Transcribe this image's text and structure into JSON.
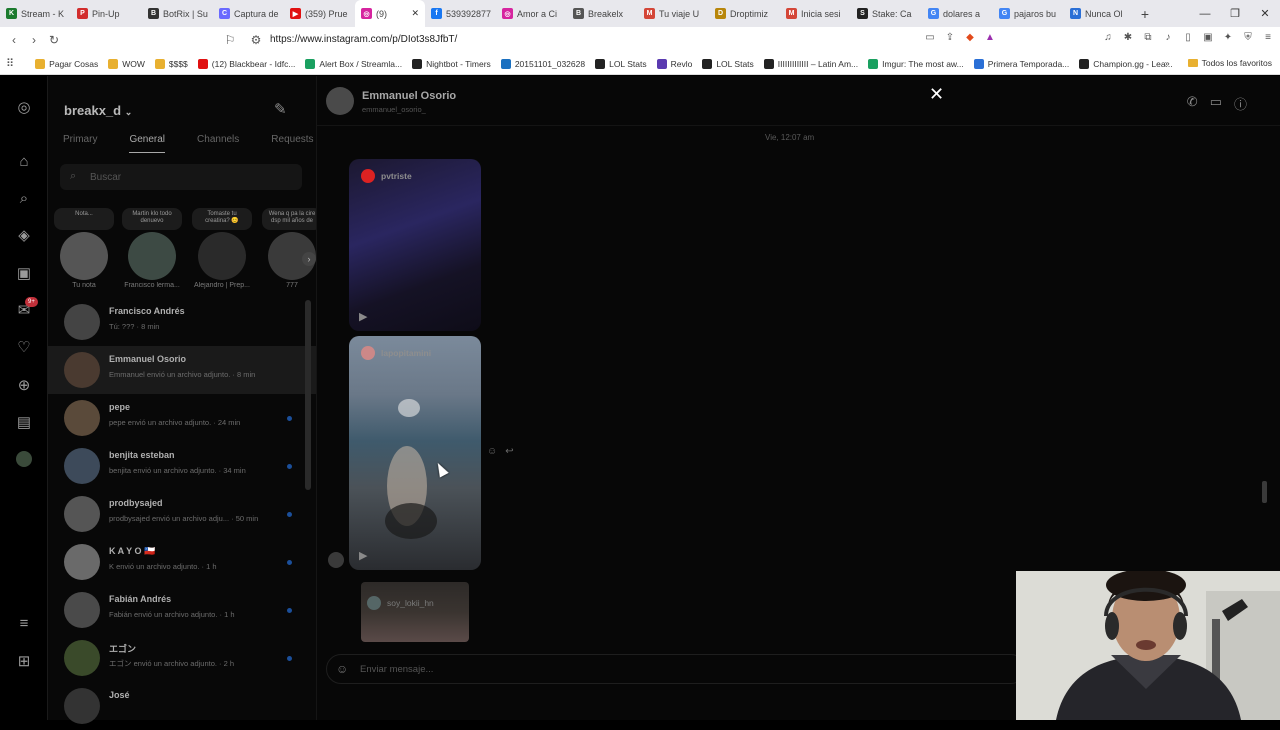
{
  "browser": {
    "tabs": [
      {
        "label": "Stream - K",
        "color": "#1b7a2e",
        "glyph": "K"
      },
      {
        "label": "Pin-Up",
        "color": "#d22d2d",
        "glyph": "P"
      },
      {
        "label": "BotRix | Su",
        "color": "#333333",
        "glyph": "B"
      },
      {
        "label": "Captura de",
        "color": "#6a6aff",
        "glyph": "C"
      },
      {
        "label": "(359) Prue",
        "color": "#e01010",
        "glyph": "▶"
      },
      {
        "label": "(9)",
        "color": "#d6249f",
        "glyph": "◎",
        "active": true
      },
      {
        "label": "539392877",
        "color": "#1877f2",
        "glyph": "f"
      },
      {
        "label": "Amor a Ci",
        "color": "#d6249f",
        "glyph": "◎"
      },
      {
        "label": "Breakelx",
        "color": "#555555",
        "glyph": "B"
      },
      {
        "label": "Tu viaje U",
        "color": "#d44638",
        "glyph": "M"
      },
      {
        "label": "Droptimiz",
        "color": "#b8860b",
        "glyph": "D"
      },
      {
        "label": "Inicia sesi",
        "color": "#d44638",
        "glyph": "M"
      },
      {
        "label": "Stake: Ca",
        "color": "#222222",
        "glyph": "S"
      },
      {
        "label": "dolares a",
        "color": "#4285f4",
        "glyph": "G"
      },
      {
        "label": "pajaros bu",
        "color": "#4285f4",
        "glyph": "G"
      },
      {
        "label": "Nunca Ol",
        "color": "#2a6fd6",
        "glyph": "N"
      }
    ],
    "url": "https://www.instagram.com/p/DIot3s8JfbT/",
    "bookmarks": [
      {
        "label": "Pagar Cosas",
        "color": "#e8b030"
      },
      {
        "label": "WOW",
        "color": "#e8b030"
      },
      {
        "label": "$$$$",
        "color": "#e8b030"
      },
      {
        "label": "(12) Blackbear - Idfc...",
        "color": "#e01010"
      },
      {
        "label": "Alert Box / Streamla...",
        "color": "#1aa060"
      },
      {
        "label": "Nightbot - Timers",
        "color": "#222222"
      },
      {
        "label": "20151101_032628",
        "color": "#1a70c0"
      },
      {
        "label": "LOL Stats",
        "color": "#222222"
      },
      {
        "label": "Revlo",
        "color": "#5a3ab0"
      },
      {
        "label": "LOL Stats",
        "color": "#222222"
      },
      {
        "label": "IIIIIIIIIIIII – Latin Am...",
        "color": "#222222"
      },
      {
        "label": "Imgur: The most aw...",
        "color": "#1aa060"
      },
      {
        "label": "Primera Temporada...",
        "color": "#2a6fd6"
      },
      {
        "label": "Champion.gg - Lea...",
        "color": "#222222"
      }
    ],
    "bookmarks_more": "»",
    "all_favorites": "Todos los favoritos"
  },
  "inbox": {
    "username": "breakx_d",
    "tabs": [
      "Primary",
      "General",
      "Channels",
      "Requests"
    ],
    "active_tab": "General",
    "search_placeholder": "Buscar",
    "notes": [
      {
        "bubble": "Nota...",
        "name": "Tu nota"
      },
      {
        "bubble": "Martin klo todo denuevo",
        "name": "Francisco lerma..."
      },
      {
        "bubble": "Tomaste tu creatina? 😊",
        "name": "Alejandro | Prep..."
      },
      {
        "bubble": "Wena q pa la cire dsp mil años de",
        "name": "777"
      }
    ],
    "conversations": [
      {
        "name": "Francisco Andrés",
        "preview": "Tú: ??? · 8 min",
        "unread": false
      },
      {
        "name": "Emmanuel Osorio",
        "preview": "Emmanuel envió un archivo adjunto. · 8 min",
        "unread": false,
        "selected": true
      },
      {
        "name": "pepe",
        "preview": "pepe envió un archivo adjunto. · 24 min",
        "unread": true
      },
      {
        "name": "benjita esteban",
        "preview": "benjita envió un archivo adjunto. · 34 min",
        "unread": true
      },
      {
        "name": "prodbysajed",
        "preview": "prodbysajed envió un archivo adju... · 50 min",
        "unread": true
      },
      {
        "name": "K A Y O 🇨🇱",
        "preview": "K envió un archivo adjunto. · 1 h",
        "unread": true
      },
      {
        "name": "Fabián Andrés",
        "preview": "Fabián envió un archivo adjunto. · 1 h",
        "unread": true
      },
      {
        "name": "エゴン",
        "preview": "エゴン envió un archivo adjunto. · 2 h",
        "unread": true
      },
      {
        "name": "José",
        "preview": "",
        "unread": false
      }
    ]
  },
  "chat": {
    "contact_name": "Emmanuel Osorio",
    "contact_handle": "emmanuel_osorio_",
    "timestamp": "Vie, 12:07 am",
    "cards": [
      {
        "account": "pvtriste"
      },
      {
        "account": "lapopitamini"
      },
      {
        "account": "soy_lokii_hn"
      }
    ],
    "input_placeholder": "Enviar mensaje..."
  },
  "rail_badge": "9+",
  "close_label": "✕"
}
